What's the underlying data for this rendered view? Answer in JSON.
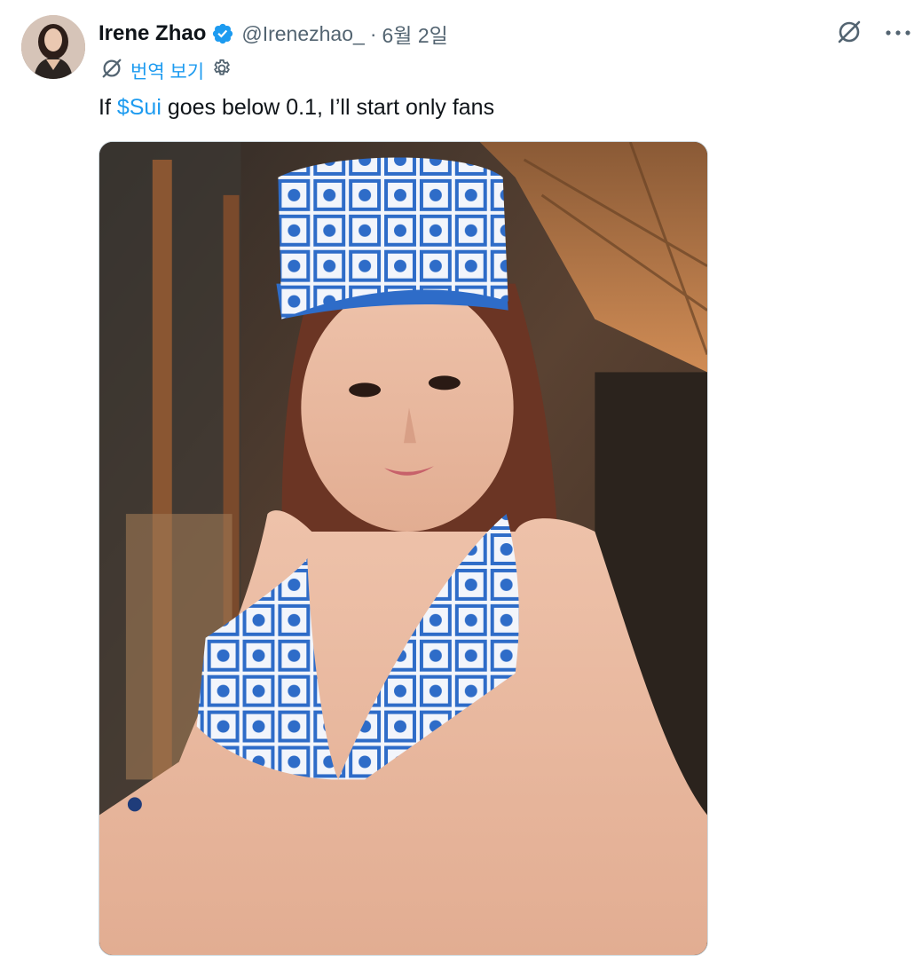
{
  "author": {
    "name": "Irene Zhao",
    "handle": "@Irenezhao_",
    "separator": "·",
    "date": "6월 2일"
  },
  "icons": {
    "verified": "verified-badge-icon",
    "grok": "grok-icon",
    "more": "more-options-icon",
    "translate": "grok-translate-icon",
    "settings": "gear-icon"
  },
  "translate": {
    "label": "번역 보기"
  },
  "tweet": {
    "text_before": "If ",
    "cashtag": "$Sui",
    "text_after": " goes below 0.1, I’ll start only fans"
  },
  "colors": {
    "accent": "#1d9bf0",
    "secondary_text": "#536471",
    "primary_text": "#0f1419"
  }
}
